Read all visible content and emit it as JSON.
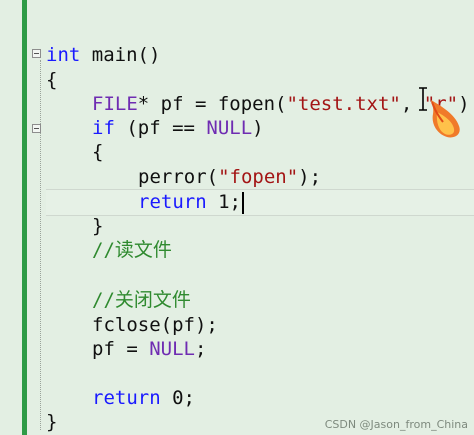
{
  "editor": {
    "lines": {
      "l1_kw": "int",
      "l1_rest": " main()",
      "l2": "{",
      "l3_macro": "FILE",
      "l3_a": "* pf = fopen(",
      "l3_str1": "\"test.txt\"",
      "l3_b": ", ",
      "l3_str2": "\"r\"",
      "l3_c": ")",
      "l4_kw": "if",
      "l4_a": " (pf == ",
      "l4_macro": "NULL",
      "l4_b": ")",
      "l5": "{",
      "l6_a": "perror(",
      "l6_str": "\"fopen\"",
      "l6_b": ");",
      "l7_kw": "return",
      "l7_rest": " 1;",
      "l8": "}",
      "l9_comment": "//读文件",
      "l10_comment": "//关闭文件",
      "l11": "fclose(pf);",
      "l12_a": "pf = ",
      "l12_macro": "NULL",
      "l12_b": ";",
      "l13_kw": "return",
      "l13_rest": " 0;",
      "l14": "}"
    }
  },
  "watermark": "CSDN @Jason_from_China",
  "colors": {
    "background": "#e3efe3",
    "keyword": "#1a1aff",
    "macro": "#6f2cb2",
    "string": "#a31515",
    "comment": "#2f8a2f",
    "change_bar": "#2e9b46"
  }
}
